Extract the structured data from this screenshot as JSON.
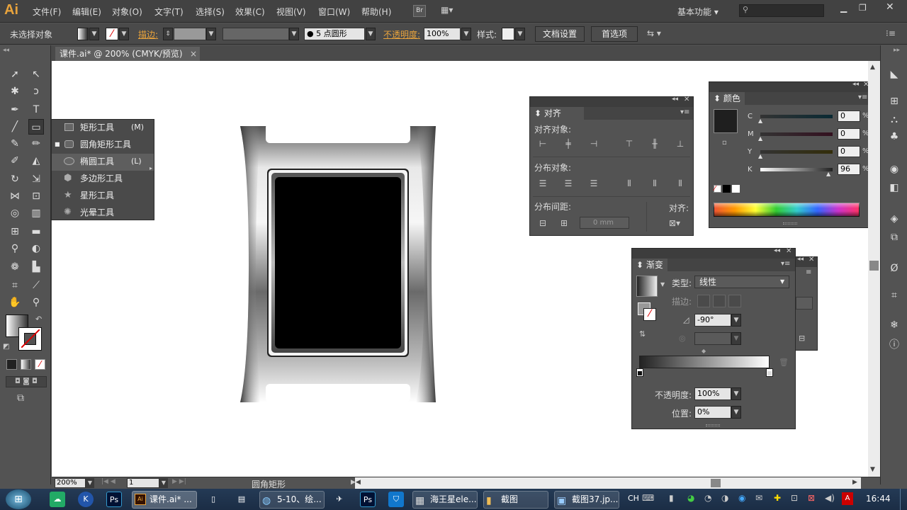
{
  "app": {
    "logo": "Ai",
    "br": "Br",
    "workspace": "基本功能"
  },
  "menu": [
    "文件(F)",
    "编辑(E)",
    "对象(O)",
    "文字(T)",
    "选择(S)",
    "效果(C)",
    "视图(V)",
    "窗口(W)",
    "帮助(H)"
  ],
  "control": {
    "selection": "未选择对象",
    "stroke_label": "描边:",
    "brush": "5 点圆形",
    "opacity_label": "不透明度:",
    "opacity_value": "100%",
    "style_label": "样式:",
    "doc_setup": "文档设置",
    "prefs": "首选项"
  },
  "document": {
    "tab": "课件.ai* @ 200% (CMYK/预览)",
    "close": "×"
  },
  "flyout": [
    {
      "label": "矩形工具",
      "key": "(M)",
      "icon": "rect-icon"
    },
    {
      "label": "圆角矩形工具",
      "key": "",
      "icon": "rounded-rect-icon"
    },
    {
      "label": "椭圆工具",
      "key": "(L)",
      "icon": "ellipse-icon"
    },
    {
      "label": "多边形工具",
      "key": "",
      "icon": "polygon-icon"
    },
    {
      "label": "星形工具",
      "key": "",
      "icon": "star-icon"
    },
    {
      "label": "光晕工具",
      "key": "",
      "icon": "flare-icon"
    }
  ],
  "align": {
    "tab": "对齐",
    "align_objects": "对齐对象:",
    "distribute_objects": "分布对象:",
    "distribute_spacing": "分布间距:",
    "align_to": "对齐:",
    "spacing_value": "0 mm"
  },
  "color": {
    "tab": "颜色",
    "channels": [
      {
        "name": "C",
        "value": "0",
        "unit": "%"
      },
      {
        "name": "M",
        "value": "0",
        "unit": "%"
      },
      {
        "name": "Y",
        "value": "0",
        "unit": "%"
      },
      {
        "name": "K",
        "value": "96",
        "unit": "%"
      }
    ]
  },
  "gradient": {
    "tab": "渐变",
    "type_label": "类型:",
    "type_value": "线性",
    "stroke_label": "描边:",
    "angle_value": "-90°",
    "opacity_label": "不透明度:",
    "opacity_value": "100%",
    "position_label": "位置:",
    "position_value": "0%"
  },
  "status": {
    "zoom": "200%",
    "page": "1",
    "tool": "圆角矩形"
  },
  "taskbar": {
    "items": [
      "课件.ai* ...",
      "5-10、绘...",
      "海王星ele...",
      "截图",
      "截图37.jp..."
    ],
    "lang": "CH",
    "clock": "16:44"
  },
  "colors": {
    "accent": "#e8a33c",
    "canvas": "#ffffff",
    "ui": "#535353"
  }
}
